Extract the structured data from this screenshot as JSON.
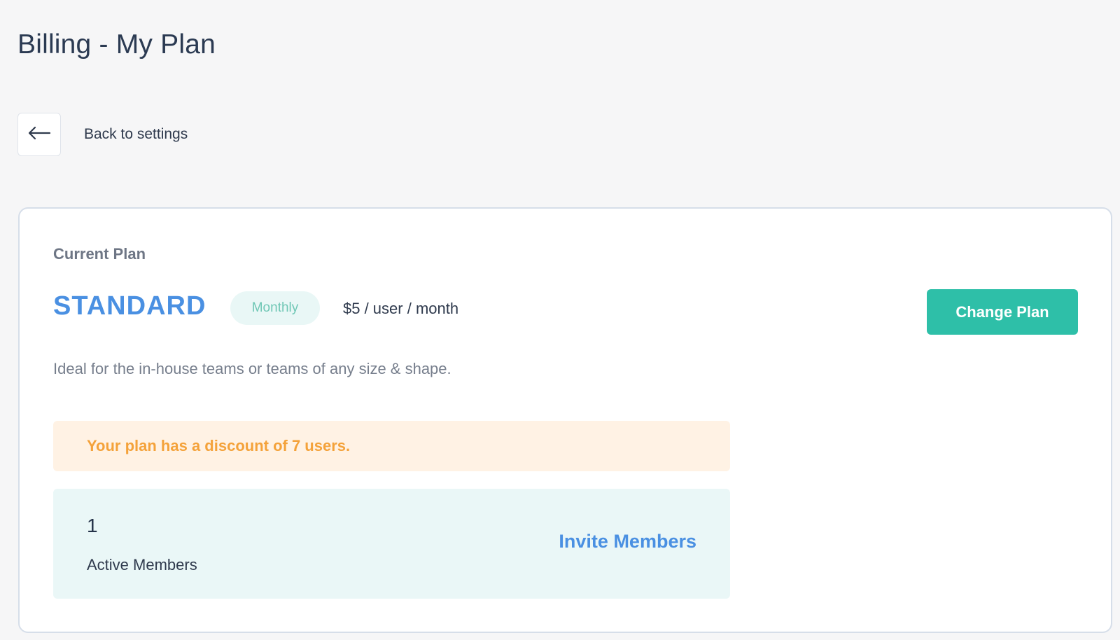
{
  "page": {
    "title": "Billing - My Plan"
  },
  "navigation": {
    "back_icon": "arrow-left-icon",
    "back_label": "Back to settings"
  },
  "plan": {
    "section_label": "Current Plan",
    "name": "STANDARD",
    "billing_period": "Monthly",
    "price": "$5 / user / month",
    "description": "Ideal for the in-house teams or teams of any size & shape.",
    "change_button_label": "Change Plan"
  },
  "discount": {
    "message": "Your plan has a discount of 7 users."
  },
  "members": {
    "active_count": "1",
    "active_label": "Active Members",
    "invite_label": "Invite Members"
  },
  "colors": {
    "brand_blue": "#4a90e2",
    "primary_teal": "#2ebfa8",
    "warning_orange": "#f4a23a",
    "page_background": "#f6f6f7"
  }
}
